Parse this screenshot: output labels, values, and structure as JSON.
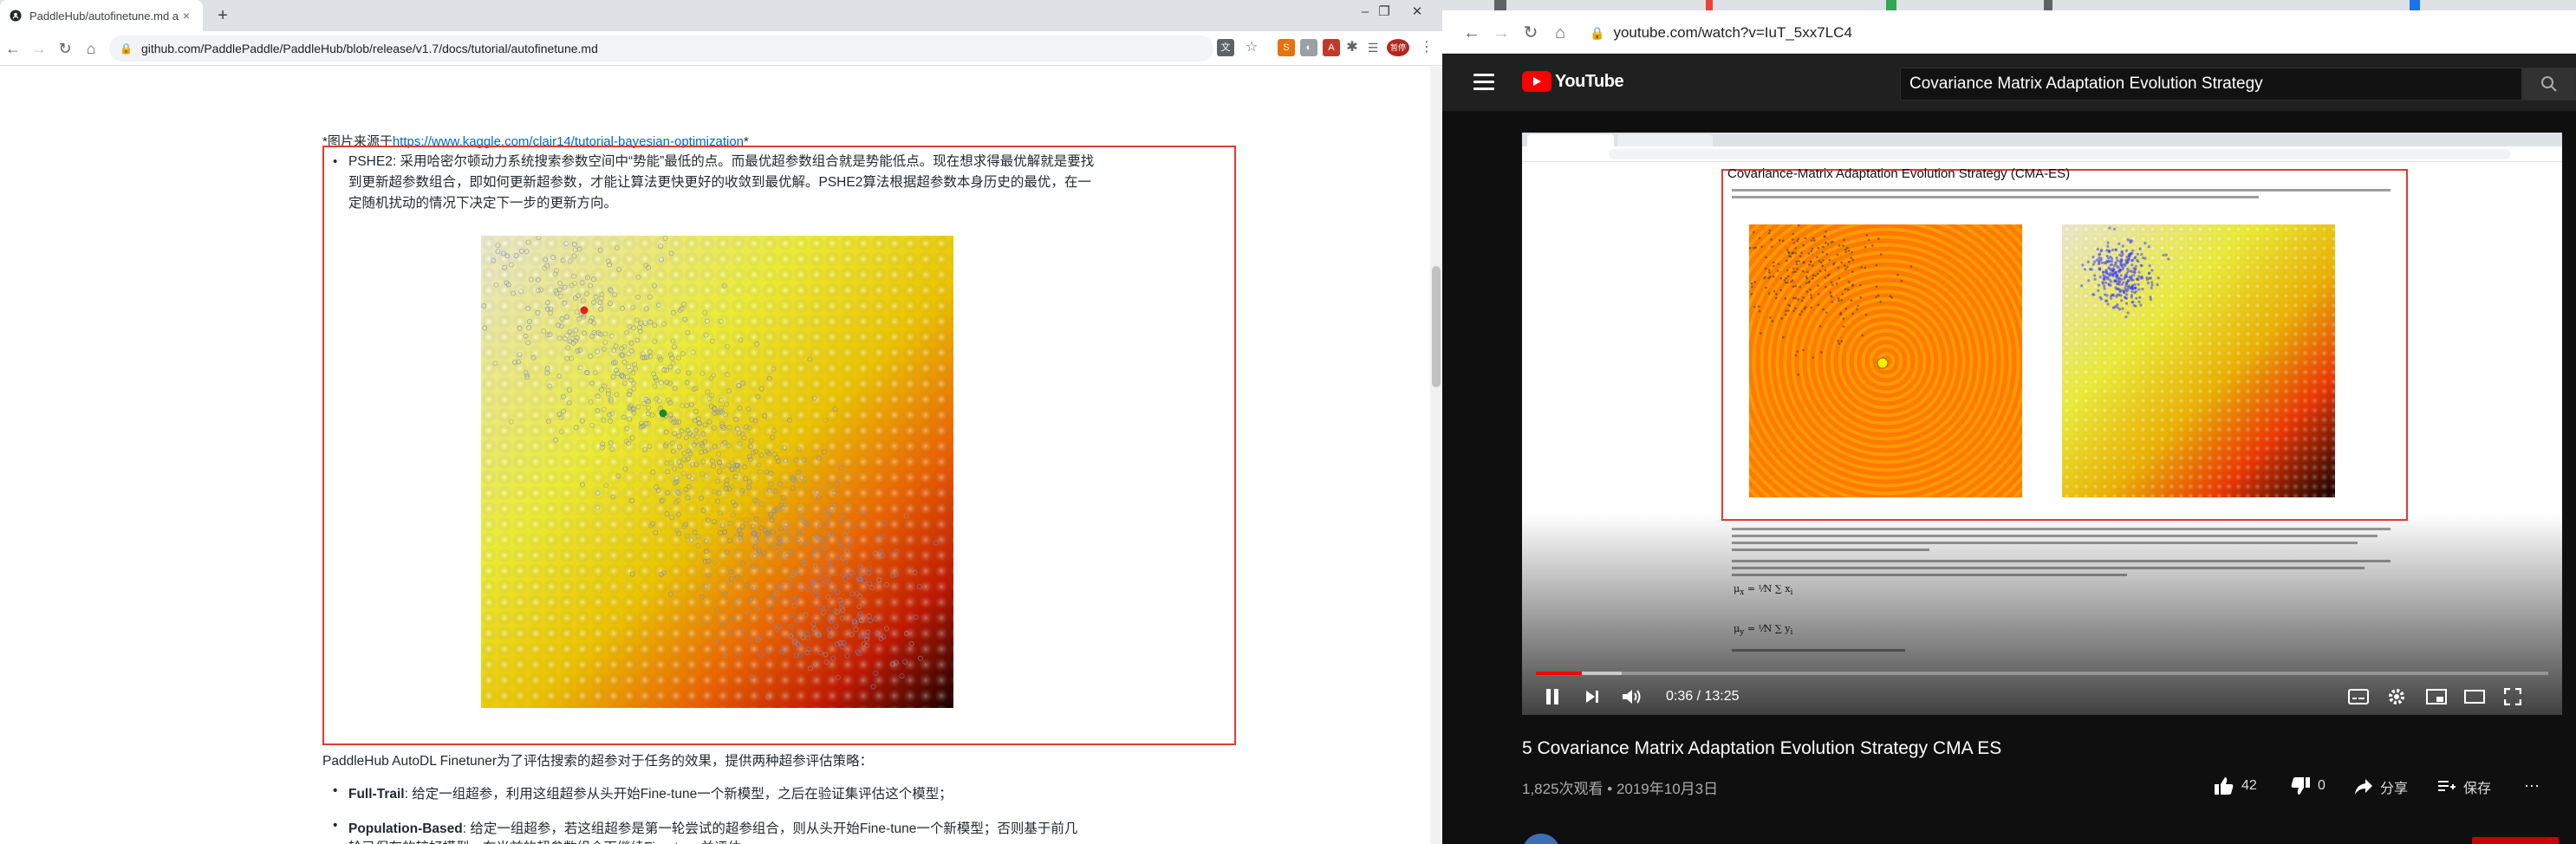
{
  "left_window": {
    "tab": {
      "title": "PaddleHub/autofinetune.md at ·",
      "close": "×"
    },
    "new_tab": "+",
    "window_controls": [
      "‒",
      "❐",
      "✕"
    ],
    "url": "github.com/PaddlePaddle/PaddleHub/blob/release/v1.7/docs/tutorial/autofinetune.md",
    "extension_badge": "暂停",
    "page": {
      "image_credit_prefix": "*图片来源于",
      "image_credit_link": "https://www.kaggle.com/clair14/tutorial-bayesian-optimization",
      "image_credit_suffix": "*",
      "pshe2_paragraph": "PSHE2: 采用哈密尔顿动力系统搜索参数空间中“势能”最低的点。而最优超参数组合就是势能低点。现在想求得最优解就是要找到更新超参数组合，即如何更新超参数，才能让算法更快更好的收敛到最优解。PSHE2算法根据超参数本身历史的最优，在一定随机扰动的情况下决定下一步的更新方向。",
      "strategy_intro": "PaddleHub AutoDL Finetuner为了评估搜索的超参对于任务的效果，提供两种超参评估策略：",
      "full_trail_label": "Full-Trail",
      "full_trail_text": ": 给定一组超参，利用这组超参从头开始Fine-tune一个新模型，之后在验证集评估这个模型；",
      "population_label": "Population-Based",
      "population_text": ": 给定一组超参，若这组超参是第一轮尝试的超参组合，则从头开始Fine-tune一个新模型；否则基于前几",
      "cut_line": "轮已保存的较好模型，在当前的超参数组合下继续Fine-tune并评估。"
    }
  },
  "right_window": {
    "url": "youtube.com/watch?v=IuT_5xx7LC4",
    "yt_logo_text": "YouTube",
    "search_value": "Covariance Matrix Adaptation Evolution Strategy",
    "embedded": {
      "title": "Covariance-Matrix Adaptation Evolution Strategy (CMA-ES)"
    },
    "player": {
      "time_current": "0:36",
      "time_total": "13:25",
      "time_separator": " / ",
      "played_fraction": 0.045,
      "buffered_fraction": 0.085
    },
    "video_title": "5 Covariance Matrix Adaptation Evolution Strategy CMA ES",
    "video_meta": "1,825次观看 • 2019年10月3日",
    "actions": {
      "likes": "42",
      "dislikes": "0",
      "share": "分享",
      "save": "保存",
      "more": "···"
    }
  },
  "colors": {
    "highlight_box": "#e53935",
    "yt_red": "#ff0000",
    "link": "#0366d6"
  }
}
